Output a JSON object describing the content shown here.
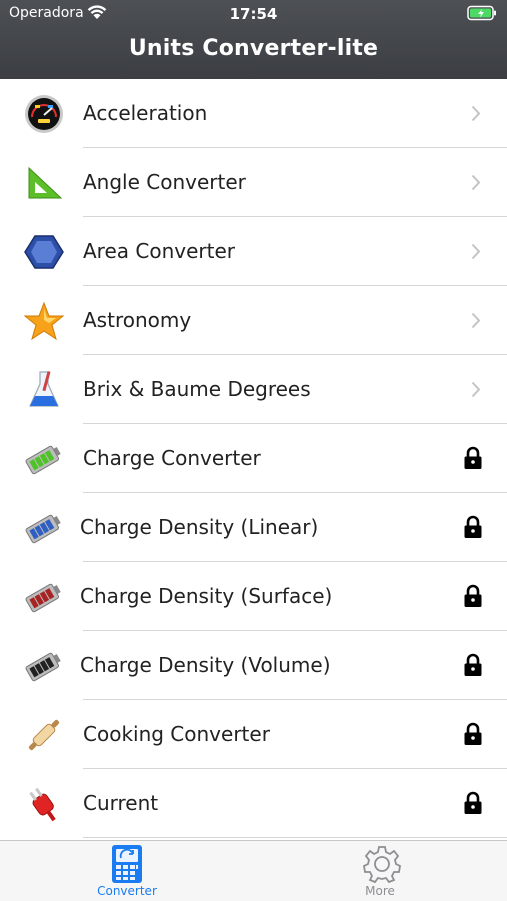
{
  "status_bar": {
    "carrier": "Operadora",
    "time": "17:54"
  },
  "nav": {
    "title": "Units Converter-lite"
  },
  "list": [
    {
      "label": "Acceleration",
      "icon": "speedometer-icon",
      "accessory": "chevron"
    },
    {
      "label": "Angle Converter",
      "icon": "set-square-icon",
      "accessory": "chevron"
    },
    {
      "label": "Area Converter",
      "icon": "hexagon-icon",
      "accessory": "chevron"
    },
    {
      "label": "Astronomy",
      "icon": "star-icon",
      "accessory": "chevron"
    },
    {
      "label": "Brix & Baume Degrees",
      "icon": "flask-icon",
      "accessory": "chevron"
    },
    {
      "label": "Charge Converter",
      "icon": "battery-green-icon",
      "accessory": "lock"
    },
    {
      "label": "Charge Density (Linear)",
      "icon": "battery-blue-icon",
      "accessory": "lock"
    },
    {
      "label": "Charge Density (Surface)",
      "icon": "battery-red-icon",
      "accessory": "lock"
    },
    {
      "label": "Charge Density (Volume)",
      "icon": "battery-black-icon",
      "accessory": "lock"
    },
    {
      "label": "Cooking Converter",
      "icon": "rolling-pin-icon",
      "accessory": "lock"
    },
    {
      "label": "Current",
      "icon": "power-plug-icon",
      "accessory": "lock"
    }
  ],
  "tabs": [
    {
      "label": "Converter",
      "icon": "calculator-icon",
      "active": true
    },
    {
      "label": "More",
      "icon": "gear-icon",
      "active": false
    }
  ],
  "colors": {
    "header": "#3f4246",
    "accent": "#1a7cf0",
    "inactive": "#8e8e93"
  }
}
